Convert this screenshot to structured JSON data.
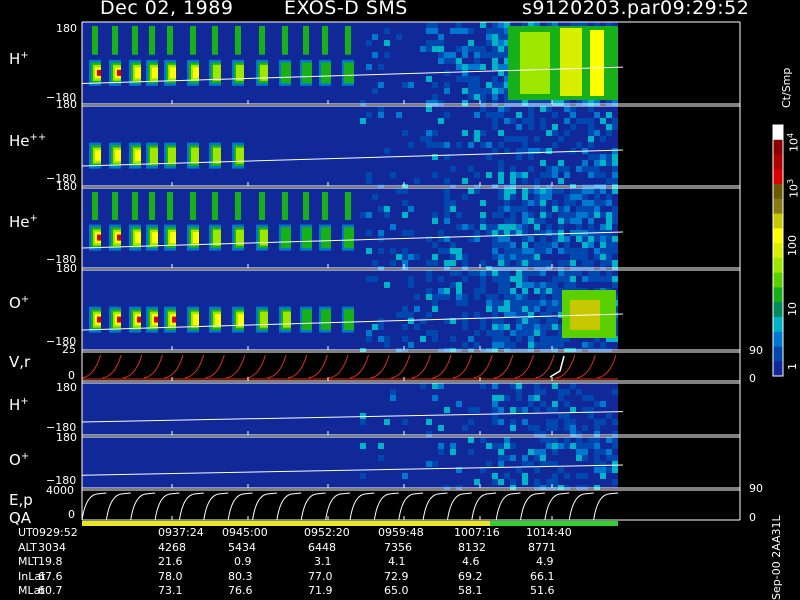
{
  "header": {
    "date": "Dec 02, 1989",
    "instrument": "EXOS-D SMS",
    "file": "s9120203.par",
    "time": "09:29:52"
  },
  "panels": [
    {
      "label": "H",
      "sup": "+",
      "ymax": "180",
      "ymin": "−180"
    },
    {
      "label": "He",
      "sup": "++",
      "ymax": "180",
      "ymin": "−180"
    },
    {
      "label": "He",
      "sup": "+",
      "ymax": "180",
      "ymin": "−180"
    },
    {
      "label": "O",
      "sup": "+",
      "ymax": "180",
      "ymin": "−180"
    },
    {
      "label": "V,r",
      "sup": "",
      "ymax": "25",
      "ymin": "0",
      "rmax": "90",
      "rmin": "0"
    },
    {
      "label": "H",
      "sup": "+",
      "ymax": "180",
      "ymin": "−180"
    },
    {
      "label": "O",
      "sup": "+",
      "ymax": "180",
      "ymin": "−180"
    },
    {
      "label": "E,p",
      "sup": "",
      "ymax": "4000",
      "ymin": "0",
      "rmax": "90",
      "rmin": "0"
    }
  ],
  "qa_label": "QA",
  "colorbar": {
    "title": "Ct/Smp",
    "ticks": [
      "10",
      "10",
      "100",
      "10",
      "1"
    ],
    "tick_sups": [
      "4",
      "3",
      "",
      "",
      ""
    ],
    "colors": [
      "#ffffff",
      "#8b0000",
      "#b00000",
      "#dd0000",
      "#6b5a00",
      "#8a7a10",
      "#c8c800",
      "#ffff00",
      "#d8f000",
      "#9ee800",
      "#5ad000",
      "#18b018",
      "#008c5a",
      "#00b4c8",
      "#0078d0",
      "#0048b0",
      "#102898"
    ]
  },
  "table": {
    "rows": [
      {
        "label": "UT",
        "values": [
          "0929:52",
          "0937:24",
          "0945:00",
          "0952:20",
          "0959:48",
          "1007:16",
          "1014:40"
        ]
      },
      {
        "label": "ALT",
        "values": [
          "3034",
          "4268",
          "5434",
          "6448",
          "7356",
          "8132",
          "8771"
        ]
      },
      {
        "label": "MLT",
        "values": [
          "19.8",
          "21.6",
          "0.9",
          "3.1",
          "4.1",
          "4.6",
          "4.9"
        ]
      },
      {
        "label": "InLat",
        "values": [
          "67.6",
          "78.0",
          "80.3",
          "77.0",
          "72.9",
          "69.2",
          "66.1"
        ]
      },
      {
        "label": "MLat",
        "values": [
          "60.7",
          "73.1",
          "76.6",
          "71.9",
          "65.0",
          "58.1",
          "51.6"
        ]
      }
    ]
  },
  "footer_version": "Sep-00 2AA31L",
  "chart_data": {
    "type": "heatmap",
    "title": "Dec 02, 1989 EXOS-D SMS",
    "x_ticks": [
      "0929:52",
      "0937:24",
      "0945:00",
      "0952:20",
      "0959:48",
      "1007:16",
      "1014:40"
    ],
    "panels": [
      {
        "name": "H+",
        "ylim": [
          -180,
          180
        ]
      },
      {
        "name": "He++",
        "ylim": [
          -180,
          180
        ]
      },
      {
        "name": "He+",
        "ylim": [
          -180,
          180
        ]
      },
      {
        "name": "O+",
        "ylim": [
          -180,
          180
        ]
      },
      {
        "name": "V,r",
        "ylim": [
          0,
          25
        ],
        "right_ylim": [
          0,
          90
        ]
      },
      {
        "name": "H+",
        "ylim": [
          -180,
          180
        ]
      },
      {
        "name": "O+",
        "ylim": [
          -180,
          180
        ]
      },
      {
        "name": "E,p",
        "ylim": [
          0,
          4000
        ],
        "right_ylim": [
          0,
          90
        ]
      }
    ],
    "colorscale": {
      "label": "Ct/Smp",
      "scale": "log",
      "range": [
        1,
        10000
      ]
    },
    "qa_segments": [
      "yellow",
      "green"
    ]
  }
}
